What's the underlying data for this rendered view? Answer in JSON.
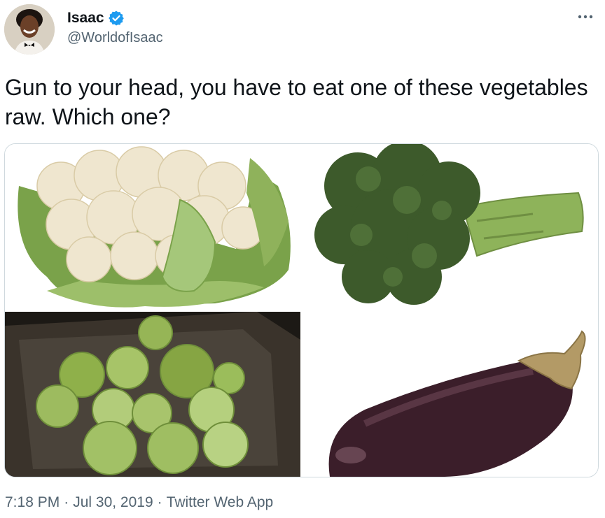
{
  "author": {
    "display_name": "Isaac",
    "handle": "@WorldofIsaac",
    "verified": true,
    "avatar_icon": "profile-photo"
  },
  "more_icon": "more-horizontal-icon",
  "tweet": {
    "text": "Gun to your head, you have to eat one of these vegetables raw. Which one?"
  },
  "media": {
    "images": [
      {
        "subject": "cauliflower"
      },
      {
        "subject": "broccoli"
      },
      {
        "subject": "brussels-sprouts"
      },
      {
        "subject": "eggplant"
      }
    ]
  },
  "meta": {
    "time": "7:18 PM",
    "separator": "·",
    "date": "Jul 30, 2019",
    "source": "Twitter Web App"
  },
  "colors": {
    "verified_blue": "#1d9bf0",
    "secondary_text": "#536471",
    "border": "#cfd9de"
  }
}
